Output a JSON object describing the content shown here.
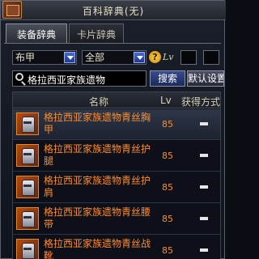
{
  "window": {
    "title": "百科辞典(无)"
  },
  "tabs": [
    {
      "label": "装备辞典"
    },
    {
      "label": "卡片辞典"
    }
  ],
  "filters": {
    "category": "布甲",
    "type": "全部",
    "help": "?",
    "lv_label": "Lv"
  },
  "search": {
    "value": "格拉西亚家族遗物",
    "button_label": "搜索",
    "default_label": "默认设置"
  },
  "list": {
    "columns": {
      "name": "名称",
      "lv": "Lv",
      "acquire": "获得方式"
    },
    "items": [
      {
        "name": "格拉西亚家族遗物青丝胸甲",
        "lv": "85"
      },
      {
        "name": "格拉西亚家族遗物青丝护腿",
        "lv": "85"
      },
      {
        "name": "格拉西亚家族遗物青丝护肩",
        "lv": "85"
      },
      {
        "name": "格拉西亚家族遗物青丝腰带",
        "lv": "85"
      },
      {
        "name": "格拉西亚家族遗物青丝战靴",
        "lv": "85"
      }
    ]
  },
  "colors": {
    "item_name": "#ff8c2a",
    "accent_button": "#2a3c7c"
  }
}
